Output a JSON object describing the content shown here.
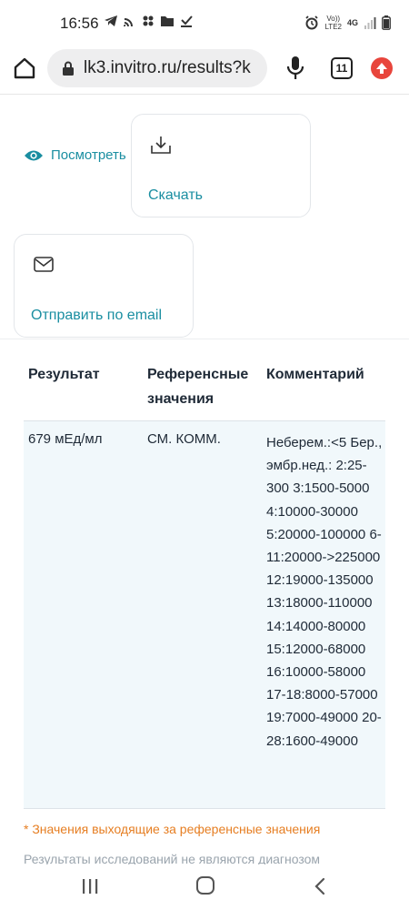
{
  "status_bar": {
    "time": "16:56",
    "network_label_top": "Vo))",
    "network_label_bottom": "LTE2",
    "network_type": "4G",
    "icons_left": [
      "telegram-icon",
      "cast-icon",
      "slack-icon",
      "folder-icon",
      "download-done-icon"
    ],
    "icons_right": [
      "alarm-icon",
      "signal-icon",
      "battery-icon"
    ]
  },
  "browser": {
    "url": "lk3.invitro.ru/results?k",
    "tab_count": "11"
  },
  "actions": {
    "view_label": "Посмотреть",
    "download_label": "Скачать",
    "email_label": "Отправить по email"
  },
  "table": {
    "headers": [
      "Результат",
      "Референсные значения",
      "Комментарий"
    ],
    "rows": [
      {
        "result": "679 мЕд/мл",
        "reference": "СМ. КОММ.",
        "comment": "Неберем.:<5 Бер., эмбр.нед.: 2:25-300 3:1500-5000 4:10000-30000 5:20000-100000 6-11:20000->225000 12:19000-135000 13:18000-110000 14:14000-80000 15:12000-68000 16:10000-58000 17-18:8000-57000 19:7000-49000 20-28:1600-49000"
      }
    ]
  },
  "footnote": "* Значения выходящие за референсные значения",
  "disclaimer": "Результаты исследований не являются диагнозом",
  "colors": {
    "accent": "#1a8ea1",
    "warning": "#e67e22",
    "row_highlight": "#f1f8fb",
    "update_badge": "#e8453c"
  }
}
